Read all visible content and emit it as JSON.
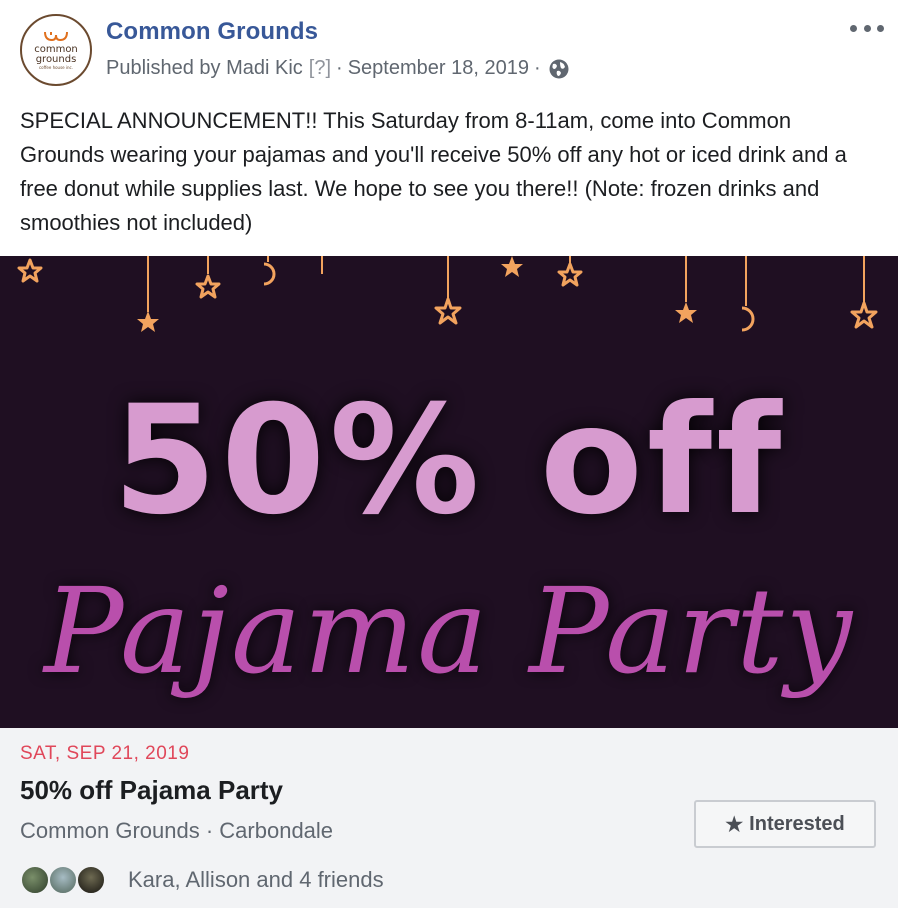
{
  "post": {
    "page_name": "Common Grounds",
    "logo": {
      "line1": "common",
      "line2": "grounds",
      "line3": "coffee house inc."
    },
    "published_by": "Published by Madi Kic",
    "help_marker": "[?]",
    "separator": "·",
    "date": "September 18, 2019",
    "privacy_icon": "globe-icon",
    "menu_icon": "more-options-icon",
    "text": "SPECIAL ANNOUNCEMENT!! This Saturday from 8-11am, come into Common Grounds wearing your pajamas and you'll receive 50% off any hot or iced drink and a free donut while supplies last. We hope to see you there!! (Note: frozen drinks and smoothies not included)"
  },
  "banner": {
    "title": "50% off",
    "subtitle": "Pajama Party",
    "background_color": "#1f0f22",
    "accent_color": "#f2a35e"
  },
  "event": {
    "date": "SAT, SEP 21, 2019",
    "title": "50% off Pajama Party",
    "location": "Common Grounds · Carbondale",
    "interested_label": "Interested",
    "interested_icon": "star-icon",
    "friends_text": "Kara, Allison and 4 friends"
  },
  "colors": {
    "link": "#385898",
    "date_red": "#e0475a",
    "muted": "#606770"
  }
}
